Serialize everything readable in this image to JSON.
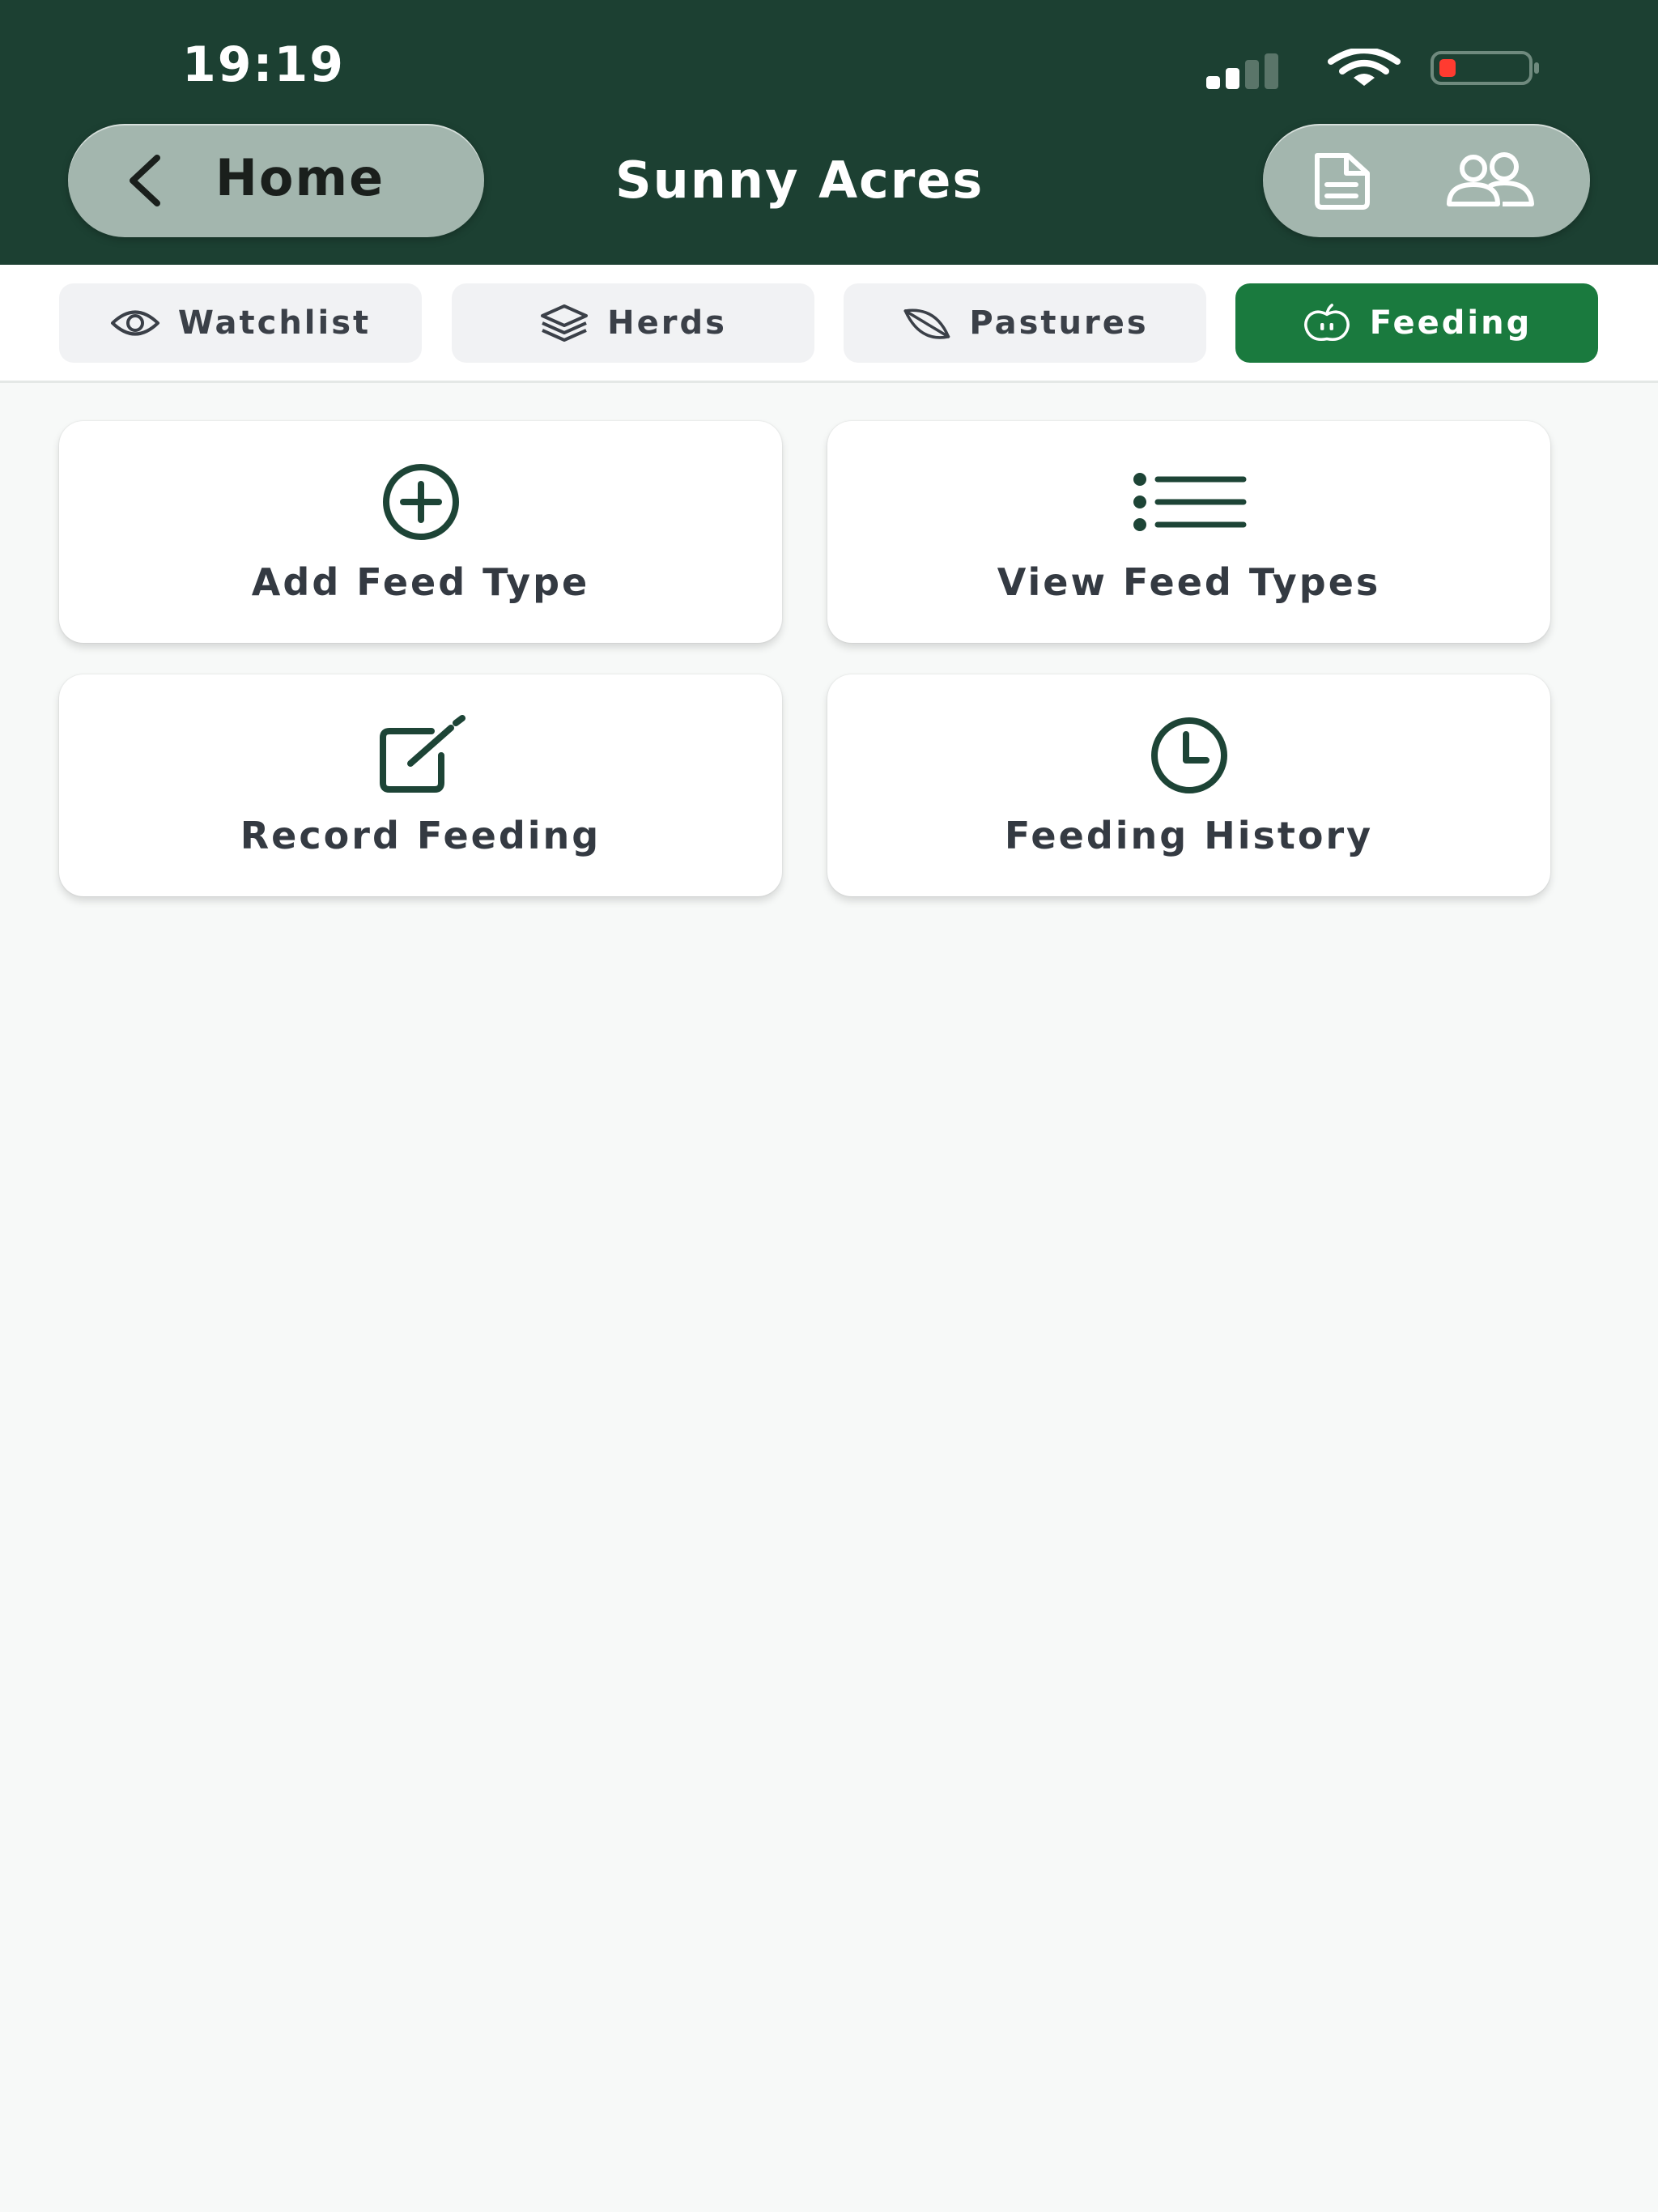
{
  "status_bar": {
    "time": "19:19"
  },
  "header": {
    "back_label": "Home",
    "title": "Sunny Acres"
  },
  "tabs": [
    {
      "label": "Watchlist",
      "icon": "eye-icon",
      "active": false
    },
    {
      "label": "Herds",
      "icon": "layers-icon",
      "active": false
    },
    {
      "label": "Pastures",
      "icon": "leaf-icon",
      "active": false
    },
    {
      "label": "Feeding",
      "icon": "apple-icon",
      "active": true
    }
  ],
  "actions": [
    {
      "label": "Add Feed Type",
      "icon": "plus-circle-icon"
    },
    {
      "label": "View Feed Types",
      "icon": "list-icon"
    },
    {
      "label": "Record Feeding",
      "icon": "edit-icon"
    },
    {
      "label": "Feeding History",
      "icon": "clock-icon"
    }
  ],
  "colors": {
    "header_bg": "#1c4032",
    "header_button_bg": "#a3b6ae",
    "active_tab": "#1a7a3e",
    "inactive_tab": "#f1f2f4",
    "icon_color": "#1d4436",
    "page_bg": "#f7f9f8",
    "battery_low": "#ff3b30"
  }
}
